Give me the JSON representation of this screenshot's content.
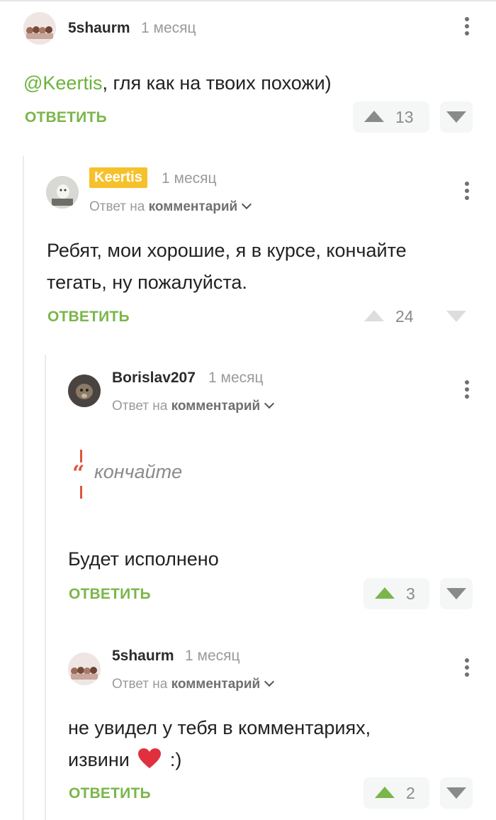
{
  "comments": [
    {
      "author": "5shaurm",
      "time": "1 месяц",
      "mention": "@Keertis",
      "text": ", гля как на твоих похожи)",
      "reply_label": "ОТВЕТИТЬ",
      "score": "13"
    },
    {
      "author": "Keertis",
      "time": "1 месяц",
      "reply_to_prefix": "Ответ на",
      "reply_to_target": "комментарий",
      "text_line1": "Ребят, мои хорошие, я в курсе, кончайте",
      "text_line2": "тегать, ну пожалуйста.",
      "reply_label": "ОТВЕТИТЬ",
      "score": "24"
    },
    {
      "author": "Borislav207",
      "time": "1 месяц",
      "reply_to_prefix": "Ответ на",
      "reply_to_target": "комментарий",
      "quote": "кончайте",
      "text": "Будет исполнено",
      "reply_label": "ОТВЕТИТЬ",
      "score": "3"
    },
    {
      "author": "5shaurm",
      "time": "1 месяц",
      "reply_to_prefix": "Ответ на",
      "reply_to_target": "комментарий",
      "text_line1": "не увидел у тебя в комментариях,",
      "text_line2_a": "извини",
      "text_line2_b": ":)",
      "reply_label": "ОТВЕТИТЬ",
      "score": "2"
    }
  ],
  "colors": {
    "accent_green": "#7ab64a",
    "badge_yellow": "#f7c12c",
    "quote_red": "#e0553b"
  }
}
